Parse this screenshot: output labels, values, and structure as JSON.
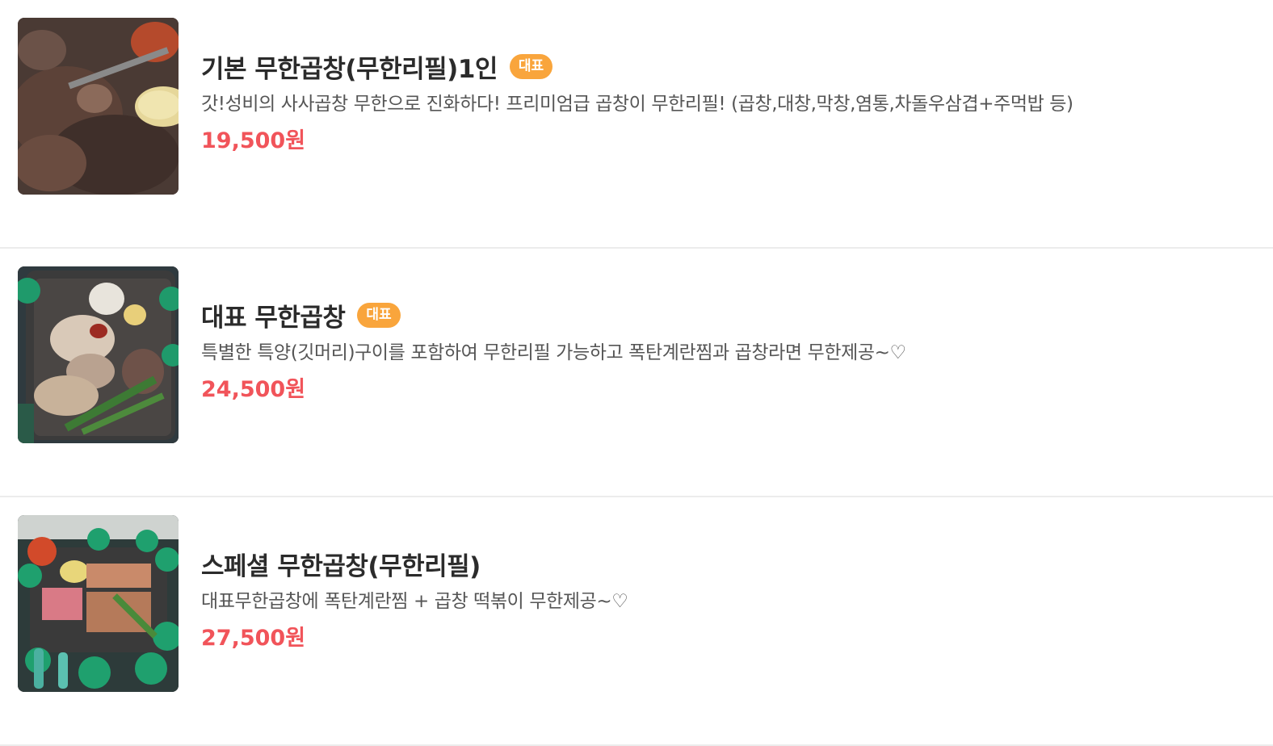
{
  "menu": {
    "items": [
      {
        "title": "기본 무한곱창(무한리필)1인",
        "badge": "대표",
        "description": "갓!성비의 사사곱창 무한으로 진화하다! 프리미엄급 곱창이 무한리필! (곱창,대창,막창,염통,차돌우삼겹+주먹밥 등)",
        "price": "19,500원"
      },
      {
        "title": "대표 무한곱창",
        "badge": "대표",
        "description": "특별한 특양(깃머리)구이를 포함하여 무한리필 가능하고 폭탄계란찜과 곱창라면 무한제공~♡",
        "price": "24,500원"
      },
      {
        "title": "스페셜 무한곱창(무한리필)",
        "description": "대표무한곱창에 폭탄계란찜 + 곱창 떡볶이 무한제공~♡",
        "price": "27,500원"
      }
    ]
  },
  "colors": {
    "badge_bg": "#f9a53c",
    "price": "#f1545a",
    "divider": "#ececec"
  }
}
